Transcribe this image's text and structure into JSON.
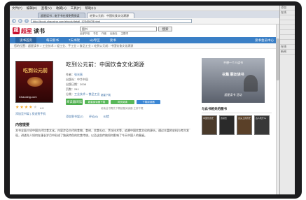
{
  "browser": {
    "menu": [
      "文件(F)",
      "编辑(E)",
      "查看(V)",
      "收藏(A)",
      "工具(T)",
      "帮助(H)"
    ],
    "tabs": [
      {
        "label": "超星读书 - 电子书在线免费阅读",
        "active": false
      },
      {
        "label": "吃到公元前：中国饮食文化溯源",
        "active": true
      }
    ],
    "url": "http://book.chaoxing.com/ebook/detail_12345678.html",
    "nav_icons": [
      "back-icon",
      "forward-icon",
      "refresh-icon"
    ]
  },
  "right_pane": {
    "rows": [
      "添加",
      "在线",
      "",
      "",
      "",
      "",
      "",
      "",
      "在线",
      "新闻"
    ]
  },
  "site": {
    "logo_mark": "超",
    "logo_text": "超星",
    "logo_text2": "读书",
    "search_placeholder": "图书",
    "search_button": "搜索",
    "search_options": [
      "全部字段",
      "书名",
      "作者",
      "出版社",
      "主题词"
    ],
    "nav": [
      "读书首页",
      "每日新书",
      "7天书架",
      "vip专区",
      "读书"
    ],
    "nav_right": "读书会员中心",
    "breadcrumb": "您的位置：超星读书 > 工业技术 > 轻工业、手工业 > 食品工业 > 吃到公元前：中国饮食文化溯源"
  },
  "book": {
    "title": "吃到公元前：中国饮食文化溯源",
    "cover_title": "吃到公元前",
    "cover_sub": "Chaoxing.com",
    "author_label": "作者：",
    "author": "张光直",
    "publisher_label": "出版社：",
    "publisher": "中华书局",
    "year_label": "出版日期：",
    "year": "2008",
    "pages_label": "页数：",
    "pages": "241",
    "category_label": "分类：",
    "category": "工业技术 > 食品工业",
    "rating_value": 4,
    "rating_text": "4.0",
    "under_stars": "添加至书架 | 发送到手机",
    "read_button": "阅读器阅读",
    "download_head": "超星下载",
    "download_buttons": [
      "超星阅读器下载",
      "网页阅读",
      "下载阅读器"
    ],
    "download_note": "阅读此书需先下载超星阅读器 立即下载",
    "share_links": [
      "添加到书架(7)",
      "评论(6)",
      "纠错"
    ]
  },
  "intro": {
    "heading": "内容提要",
    "text": "本书全面介绍中国古代饮食文化。内容涉及古代的食物、食材、饮食礼仪、烹饪技术等，追溯中国饮食文化的源头。通过丰富的史料与考古发现，讲述先人如何在漫长岁月中形成了独具特色的饮食传统，以及这些传统如何影响了今天中国人的餐桌。"
  },
  "sidebar": {
    "ad_top": "不想一个人读书",
    "ad_mid": "召集 朋友读书",
    "ad_bot": "超星读书 活动",
    "section_head": "与此书相关的图书",
    "books": [
      "中国饮食史",
      "食货志",
      "舌尖上的历史",
      "古人吃什么"
    ]
  }
}
